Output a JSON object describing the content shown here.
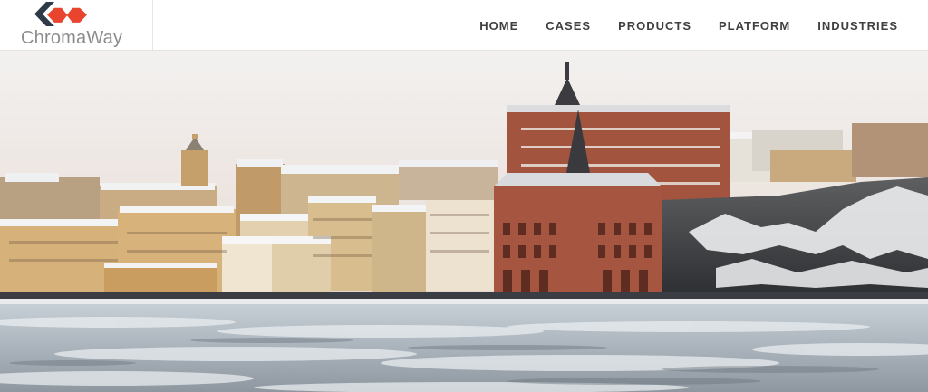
{
  "brand": {
    "name": "ChromaWay",
    "colors": {
      "dark": "#2f3a48",
      "accent": "#e8442e"
    }
  },
  "nav": {
    "items": [
      {
        "label": "HOME"
      },
      {
        "label": "CASES"
      },
      {
        "label": "PRODUCTS"
      },
      {
        "label": "PLATFORM"
      },
      {
        "label": "INDUSTRIES"
      }
    ]
  },
  "hero": {
    "image": "winter-city-waterfront-photo"
  }
}
